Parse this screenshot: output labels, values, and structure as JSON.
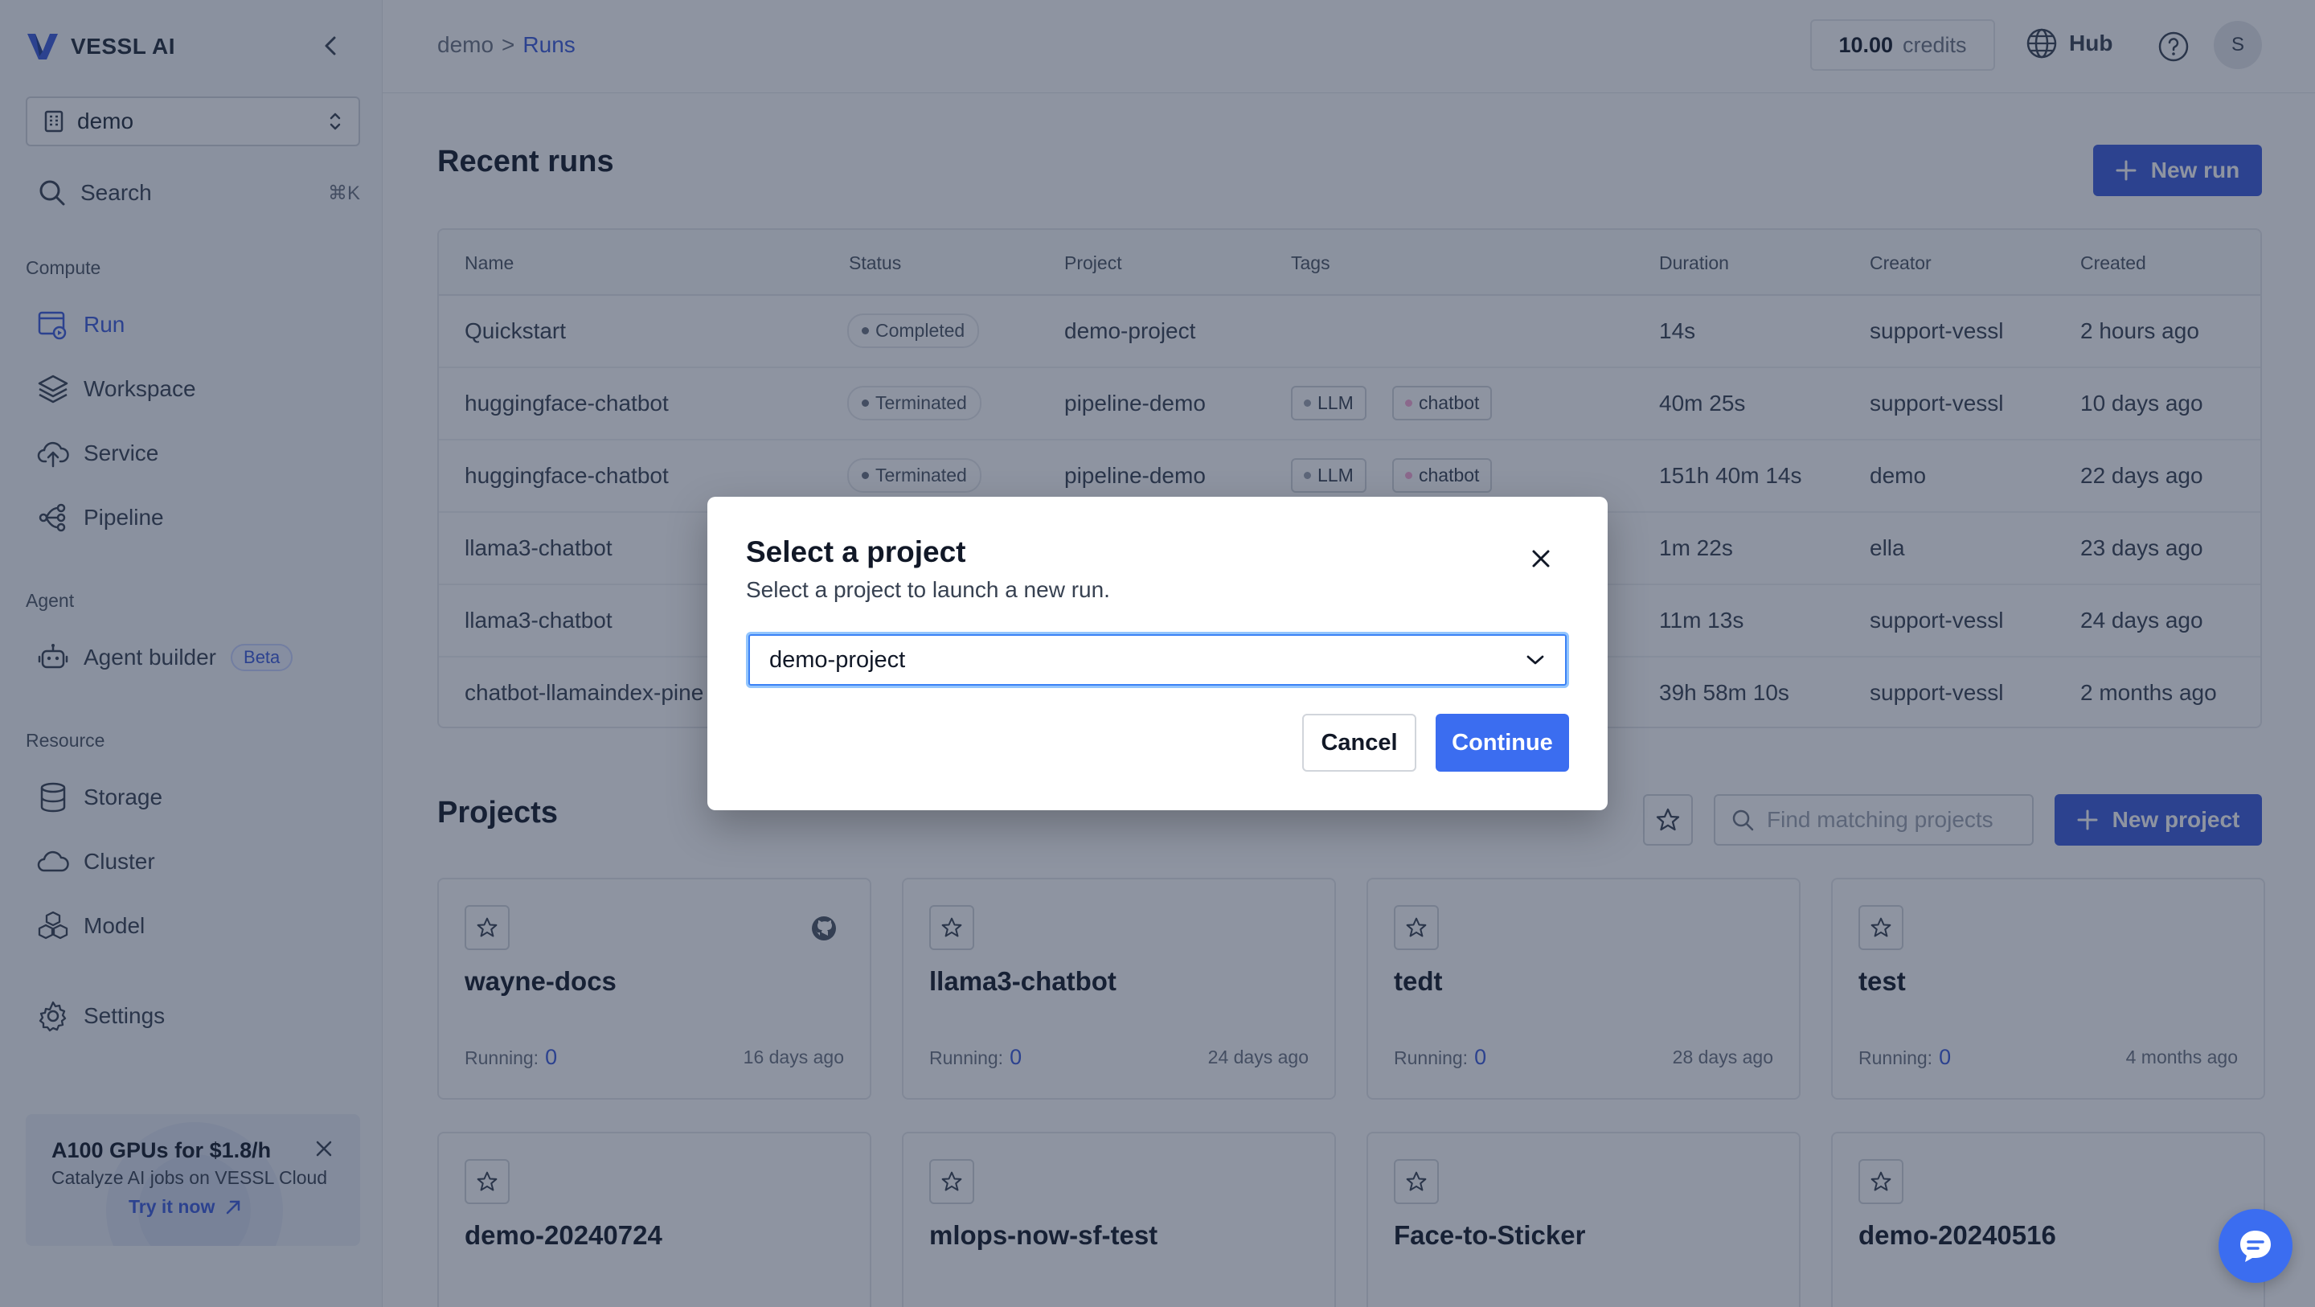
{
  "sidebar": {
    "brand": "VESSL AI",
    "workspace": "demo",
    "search_label": "Search",
    "search_shortcut": "⌘K",
    "sections": {
      "compute": "Compute",
      "agent": "Agent",
      "resource": "Resource"
    },
    "items": {
      "run": "Run",
      "workspace": "Workspace",
      "service": "Service",
      "pipeline": "Pipeline",
      "agent_builder": "Agent builder",
      "beta": "Beta",
      "storage": "Storage",
      "cluster": "Cluster",
      "model": "Model",
      "settings": "Settings"
    },
    "promo": {
      "title": "A100 GPUs for $1.8/h",
      "subtitle": "Catalyze AI jobs on VESSL Cloud",
      "link": "Try it now"
    }
  },
  "header": {
    "breadcrumb_root": "demo",
    "breadcrumb_sep": ">",
    "breadcrumb_current": "Runs",
    "credits_value": "10.00",
    "credits_label": "credits",
    "hub": "Hub",
    "avatar_initial": "S"
  },
  "runs": {
    "title": "Recent runs",
    "new_button": "New run",
    "columns": [
      "Name",
      "Status",
      "Project",
      "Tags",
      "Duration",
      "Creator",
      "Created"
    ],
    "rows": [
      {
        "name": "Quickstart",
        "status": "Completed",
        "project": "demo-project",
        "tags": [],
        "duration": "14s",
        "creator": "support-vessl",
        "created": "2 hours ago"
      },
      {
        "name": "huggingface-chatbot",
        "status": "Terminated",
        "project": "pipeline-demo",
        "tags": [
          "LLM",
          "chatbot"
        ],
        "duration": "40m 25s",
        "creator": "support-vessl",
        "created": "10 days ago"
      },
      {
        "name": "huggingface-chatbot",
        "status": "Terminated",
        "project": "pipeline-demo",
        "tags": [
          "LLM",
          "chatbot"
        ],
        "duration": "151h 40m 14s",
        "creator": "demo",
        "created": "22 days ago"
      },
      {
        "name": "llama3-chatbot",
        "status": "",
        "project": "",
        "tags": [],
        "duration": "1m 22s",
        "creator": "ella",
        "created": "23 days ago"
      },
      {
        "name": "llama3-chatbot",
        "status": "",
        "project": "",
        "tags": [],
        "duration": "11m 13s",
        "creator": "support-vessl",
        "created": "24 days ago"
      },
      {
        "name": "chatbot-llamaindex-pine",
        "status": "",
        "project": "",
        "tags": [],
        "duration": "39h 58m 10s",
        "creator": "support-vessl",
        "created": "2 months ago"
      }
    ]
  },
  "projects": {
    "title": "Projects",
    "search_placeholder": "Find matching projects",
    "new_button": "New project",
    "running_label": "Running:",
    "cards": [
      {
        "name": "wayne-docs",
        "running": "0",
        "ago": "16 days ago"
      },
      {
        "name": "llama3-chatbot",
        "running": "0",
        "ago": "24 days ago"
      },
      {
        "name": "tedt",
        "running": "0",
        "ago": "28 days ago"
      },
      {
        "name": "test",
        "running": "0",
        "ago": "4 months ago"
      },
      {
        "name": "demo-20240724",
        "running": "",
        "ago": ""
      },
      {
        "name": "mlops-now-sf-test",
        "running": "",
        "ago": ""
      },
      {
        "name": "Face-to-Sticker",
        "running": "",
        "ago": ""
      },
      {
        "name": "demo-20240516",
        "running": "",
        "ago": ""
      }
    ]
  },
  "modal": {
    "title": "Select a project",
    "subtitle": "Select a project to launch a new run.",
    "selected": "demo-project",
    "cancel": "Cancel",
    "continue": "Continue"
  },
  "colors": {
    "accent": "#3b5bdb",
    "overlay": "#1e2a44"
  }
}
